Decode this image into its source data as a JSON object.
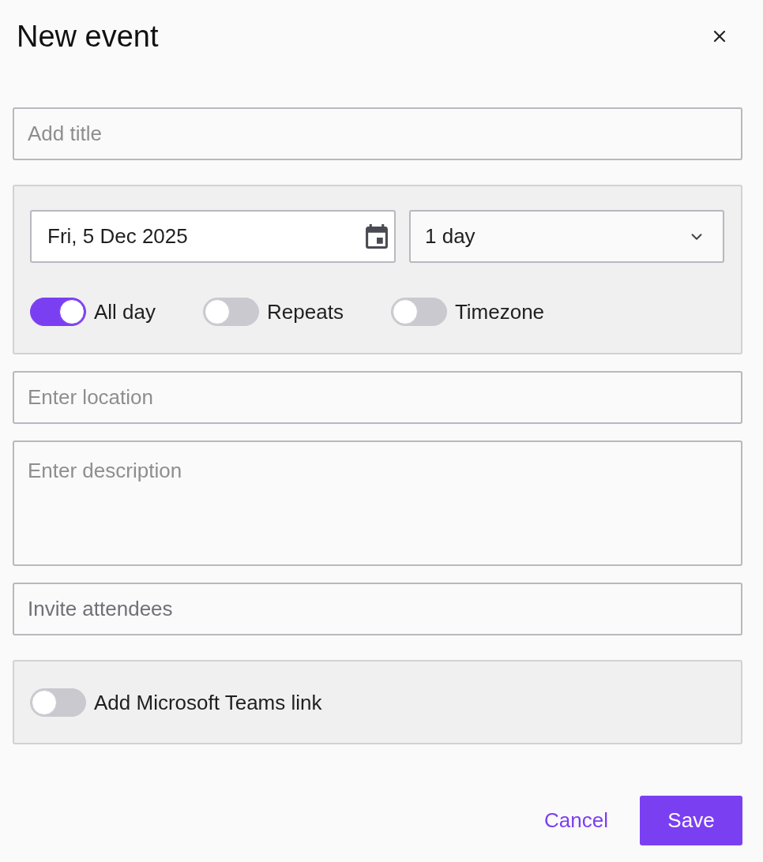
{
  "dialog": {
    "title": "New event"
  },
  "title_field": {
    "placeholder": "Add title"
  },
  "date_panel": {
    "date": "Fri, 5 Dec 2025",
    "duration": "1 day",
    "toggles": [
      {
        "label": "All day",
        "on": true
      },
      {
        "label": "Repeats",
        "on": false
      },
      {
        "label": "Timezone",
        "on": false
      }
    ]
  },
  "location_field": {
    "placeholder": "Enter location"
  },
  "description_field": {
    "placeholder": "Enter description"
  },
  "attendees_field": {
    "placeholder": "Invite attendees"
  },
  "teams_panel": {
    "toggle": {
      "label": "Add Microsoft Teams link",
      "on": false
    }
  },
  "buttons": [
    {
      "label": "Cancel",
      "kind": "text"
    },
    {
      "label": "Save",
      "kind": "primary"
    }
  ]
}
